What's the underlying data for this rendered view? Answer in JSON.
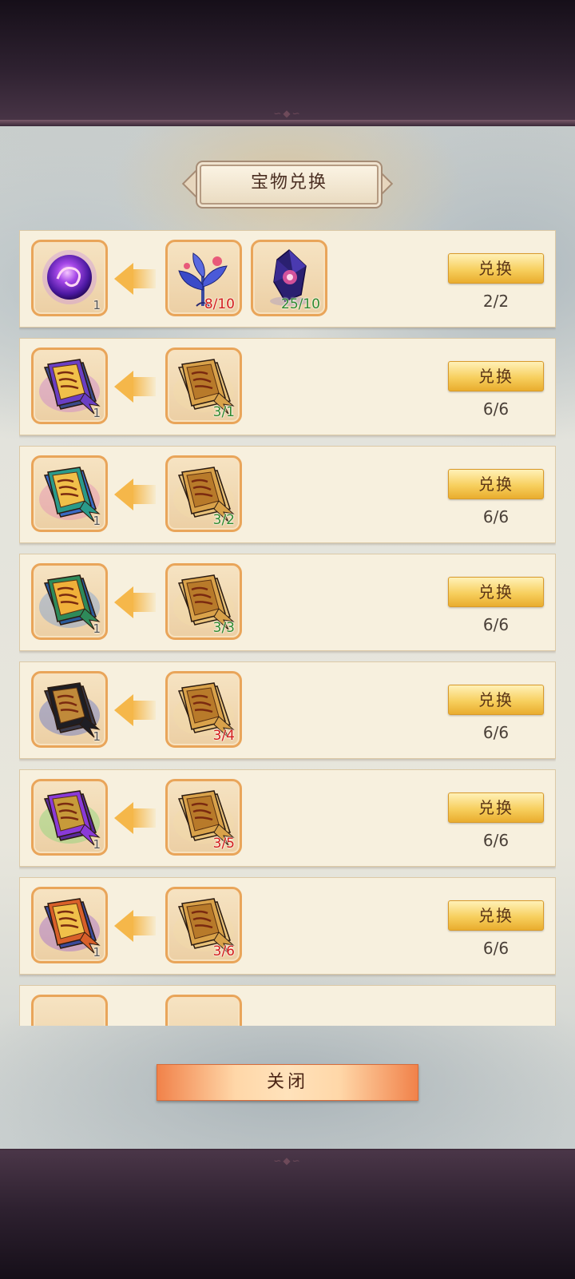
{
  "dialog": {
    "title": "宝物兑换",
    "close_label": "关闭"
  },
  "exchange_rows": [
    {
      "output": {
        "icon": "purple-orb-icon",
        "count": "1"
      },
      "inputs": [
        {
          "icon": "blue-herb-icon",
          "count": "8/10",
          "status": "short"
        },
        {
          "icon": "purple-crystal-icon",
          "count": "25/10",
          "status": "enough"
        }
      ],
      "button_label": "兑换",
      "limit": "2/2"
    },
    {
      "output": {
        "icon": "purple-scroll-icon",
        "count": "1"
      },
      "inputs": [
        {
          "icon": "golden-scroll-icon",
          "count": "3/1",
          "status": "enough"
        }
      ],
      "button_label": "兑换",
      "limit": "6/6"
    },
    {
      "output": {
        "icon": "rainbow-scroll-icon",
        "count": "1"
      },
      "inputs": [
        {
          "icon": "golden-scroll-icon",
          "count": "3/2",
          "status": "enough"
        }
      ],
      "button_label": "兑换",
      "limit": "6/6"
    },
    {
      "output": {
        "icon": "green-blue-scroll-icon",
        "count": "1"
      },
      "inputs": [
        {
          "icon": "golden-scroll-icon",
          "count": "3/3",
          "status": "enough"
        }
      ],
      "button_label": "兑换",
      "limit": "6/6"
    },
    {
      "output": {
        "icon": "black-scroll-icon",
        "count": "1"
      },
      "inputs": [
        {
          "icon": "golden-scroll-icon",
          "count": "3/4",
          "status": "short"
        }
      ],
      "button_label": "兑换",
      "limit": "6/6"
    },
    {
      "output": {
        "icon": "violet-scroll-icon",
        "count": "1"
      },
      "inputs": [
        {
          "icon": "golden-scroll-icon",
          "count": "3/5",
          "status": "short"
        }
      ],
      "button_label": "兑换",
      "limit": "6/6"
    },
    {
      "output": {
        "icon": "orange-scroll-icon",
        "count": "1"
      },
      "inputs": [
        {
          "icon": "golden-scroll-icon",
          "count": "3/6",
          "status": "short"
        }
      ],
      "button_label": "兑换",
      "limit": "6/6"
    }
  ],
  "colors": {
    "short": "#d31c1c",
    "enough": "#2f8a2f",
    "slot_border": "#e9a55a",
    "button_gold": "#f7cf5e"
  }
}
